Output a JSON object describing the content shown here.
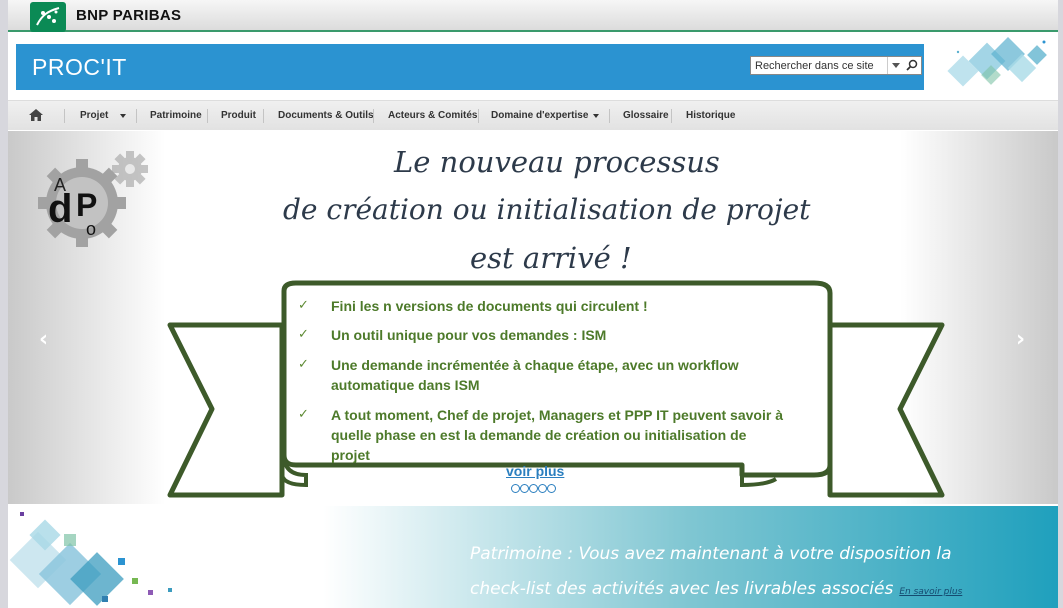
{
  "brand": {
    "name": "BNP PARIBAS",
    "logo_color": "#0b8a55"
  },
  "header": {
    "title": "PROC'IT",
    "background": "#2b93d1",
    "search": {
      "placeholder": "Rechercher dans ce site",
      "value": ""
    }
  },
  "nav": {
    "items": [
      {
        "label": "Projet",
        "has_dropdown": true
      },
      {
        "label": "Patrimoine",
        "has_dropdown": false
      },
      {
        "label": "Produit",
        "has_dropdown": false
      },
      {
        "label": "Documents & Outils",
        "has_dropdown": false
      },
      {
        "label": "Acteurs & Comités",
        "has_dropdown": false
      },
      {
        "label": "Domaine d'expertise",
        "has_dropdown": true
      },
      {
        "label": "Glossaire",
        "has_dropdown": false
      },
      {
        "label": "Historique",
        "has_dropdown": false
      }
    ]
  },
  "carousel": {
    "logo_letters": {
      "a": "A",
      "d": "d",
      "p": "P",
      "o": "o"
    },
    "headline": [
      "Le nouveau processus",
      "de création ou initialisation  de projet",
      "est arrivé !"
    ],
    "check_symbol": "✓",
    "checklist": [
      "Fini les n versions de documents qui circulent !",
      "Un outil unique pour vos demandes : ISM",
      "Une demande incrémentée à chaque étape, avec un workflow automatique dans ISM",
      "A tout moment, Chef de projet, Managers et    PPP IT peuvent savoir à quelle phase en est la demande de création ou initialisation de projet"
    ],
    "read_more": "voir plus",
    "slide_count": 5,
    "prev_arrow": "‹",
    "next_arrow": "›",
    "ribbon_color": "#3d5a2a",
    "text_color": "#4d7a2a"
  },
  "banner": {
    "line1": "Patrimoine : Vous avez maintenant à votre disposition la",
    "line2": "check-list des activités avec les livrables associés",
    "link": "En savoir plus"
  }
}
